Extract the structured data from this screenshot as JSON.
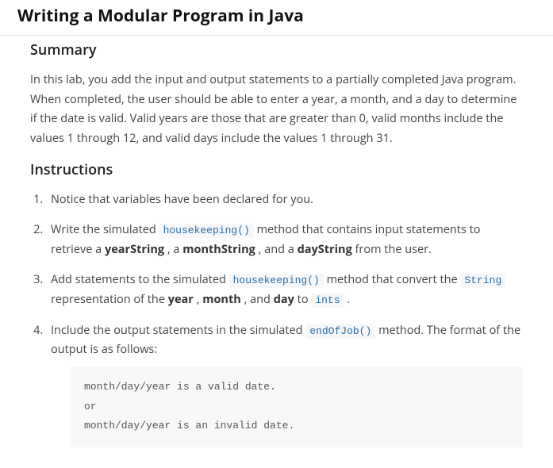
{
  "title": "Writing a Modular Program in Java",
  "summary": {
    "heading": "Summary",
    "body": "In this lab, you add the input and output statements to a partially completed Java program. When completed, the user should be able to enter a year, a month, and a day to determine if the date is valid. Valid years are those that are greater than 0, valid months include the values 1 through 12, and valid days include the values 1 through 31."
  },
  "instructions": {
    "heading": "Instructions",
    "items": {
      "i1": "Notice that variables have been declared for you.",
      "i2": {
        "t1": "Write the simulated ",
        "c1": "housekeeping()",
        "t2": " method that contains input statements to retrieve a ",
        "b1": "yearString",
        "t3": ", a ",
        "b2": "monthString",
        "t4": ", and a ",
        "b3": "dayString",
        "t5": " from the user."
      },
      "i3": {
        "t1": "Add statements to the simulated ",
        "c1": "housekeeping()",
        "t2": " method that convert the ",
        "c2": "String",
        "t3": " representation of the ",
        "b1": "year",
        "t4": ", ",
        "b2": "month",
        "t5": ", and ",
        "b3": "day",
        "t6": " to ",
        "c3": "ints",
        "t7": " ."
      },
      "i4": {
        "t1": "Include the output statements in the simulated ",
        "c1": "endOfJob()",
        "t2": " method. The format of the output is as follows:"
      }
    },
    "codeblock": "month/day/year is a valid date.\nor\nmonth/day/year is an invalid date."
  }
}
